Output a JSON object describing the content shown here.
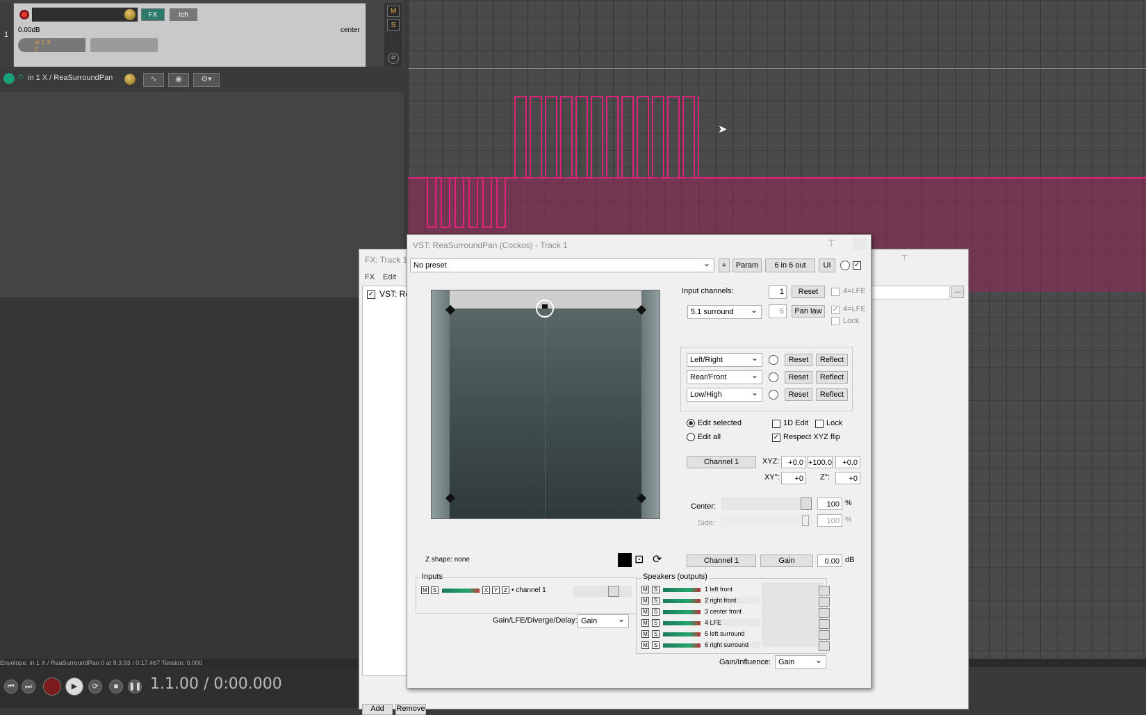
{
  "track": {
    "number": "1",
    "volume": "0.00dB",
    "pan": "center",
    "fx_label": "FX",
    "env_label": "tch",
    "input": "in 1 X",
    "input_sub": "0",
    "m_label": "M",
    "s_label": "S"
  },
  "envelope_lane": {
    "label": "in 1 X / ReaSurroundPan"
  },
  "status": {
    "text": "Envelope: in 1 X / ReaSurroundPan 0 at 9.3.93 / 0:17.467 Tension: 0.000"
  },
  "transport": {
    "time": "1.1.00 / 0:00.000"
  },
  "fxchain": {
    "title": "FX: Track 1",
    "menu_fx": "FX",
    "menu_edit": "Edit",
    "item": "VST: Re",
    "add": "Add",
    "remove": "Remove"
  },
  "plugin": {
    "title": "VST: ReaSurroundPan (Cockos) - Track 1",
    "preset": "No preset",
    "plus": "+",
    "param": "Param",
    "io": "6 in 6 out",
    "ui": "UI",
    "input_channels_label": "Input channels:",
    "input_channels": "1",
    "reset": "Reset",
    "lfe_label": "4=LFE",
    "layout": "5.1 surround",
    "out_channels": "6",
    "pan_law": "Pan law",
    "lock": "Lock",
    "axes": [
      {
        "name": "Left/Right",
        "reset": "Reset",
        "reflect": "Reflect"
      },
      {
        "name": "Rear/Front",
        "reset": "Reset",
        "reflect": "Reflect"
      },
      {
        "name": "Low/High",
        "reset": "Reset",
        "reflect": "Reflect"
      }
    ],
    "edit_selected": "Edit selected",
    "edit_all": "Edit all",
    "edit_1d": "1D Edit",
    "respect_flip": "Respect XYZ flip",
    "channel_btn": "Channel 1",
    "xyz_label": "XYZ:",
    "x": "+0.0",
    "y": "+100.0",
    "z": "+0.0",
    "xy_deg_label": "XY°:",
    "xy_deg": "+0",
    "z_deg_label": "Z°:",
    "z_deg": "+0",
    "center_label": "Center:",
    "center_val": "100",
    "side_label": "Side:",
    "side_val": "100",
    "pct": "%",
    "zshape": "Z shape: none",
    "channel_btn2": "Channel 1",
    "gain_btn": "Gain",
    "gain_val": "0.00",
    "db": "dB",
    "inputs_label": "Inputs",
    "input_channel": "channel 1",
    "gain_lfe_label": "Gain/LFE/Diverge/Delay:",
    "gain_lfe_sel": "Gain",
    "speakers_label": "Speakers (outputs)",
    "speakers": [
      "1 left front",
      "2 right front",
      "3 center front",
      "4 LFE",
      "5 left surround",
      "6 right surround"
    ],
    "gain_influence_label": "Gain/Influence:",
    "gain_influence_sel": "Gain"
  },
  "colors": {
    "envelope": "#e0237a",
    "accent": "#1aa07a"
  }
}
